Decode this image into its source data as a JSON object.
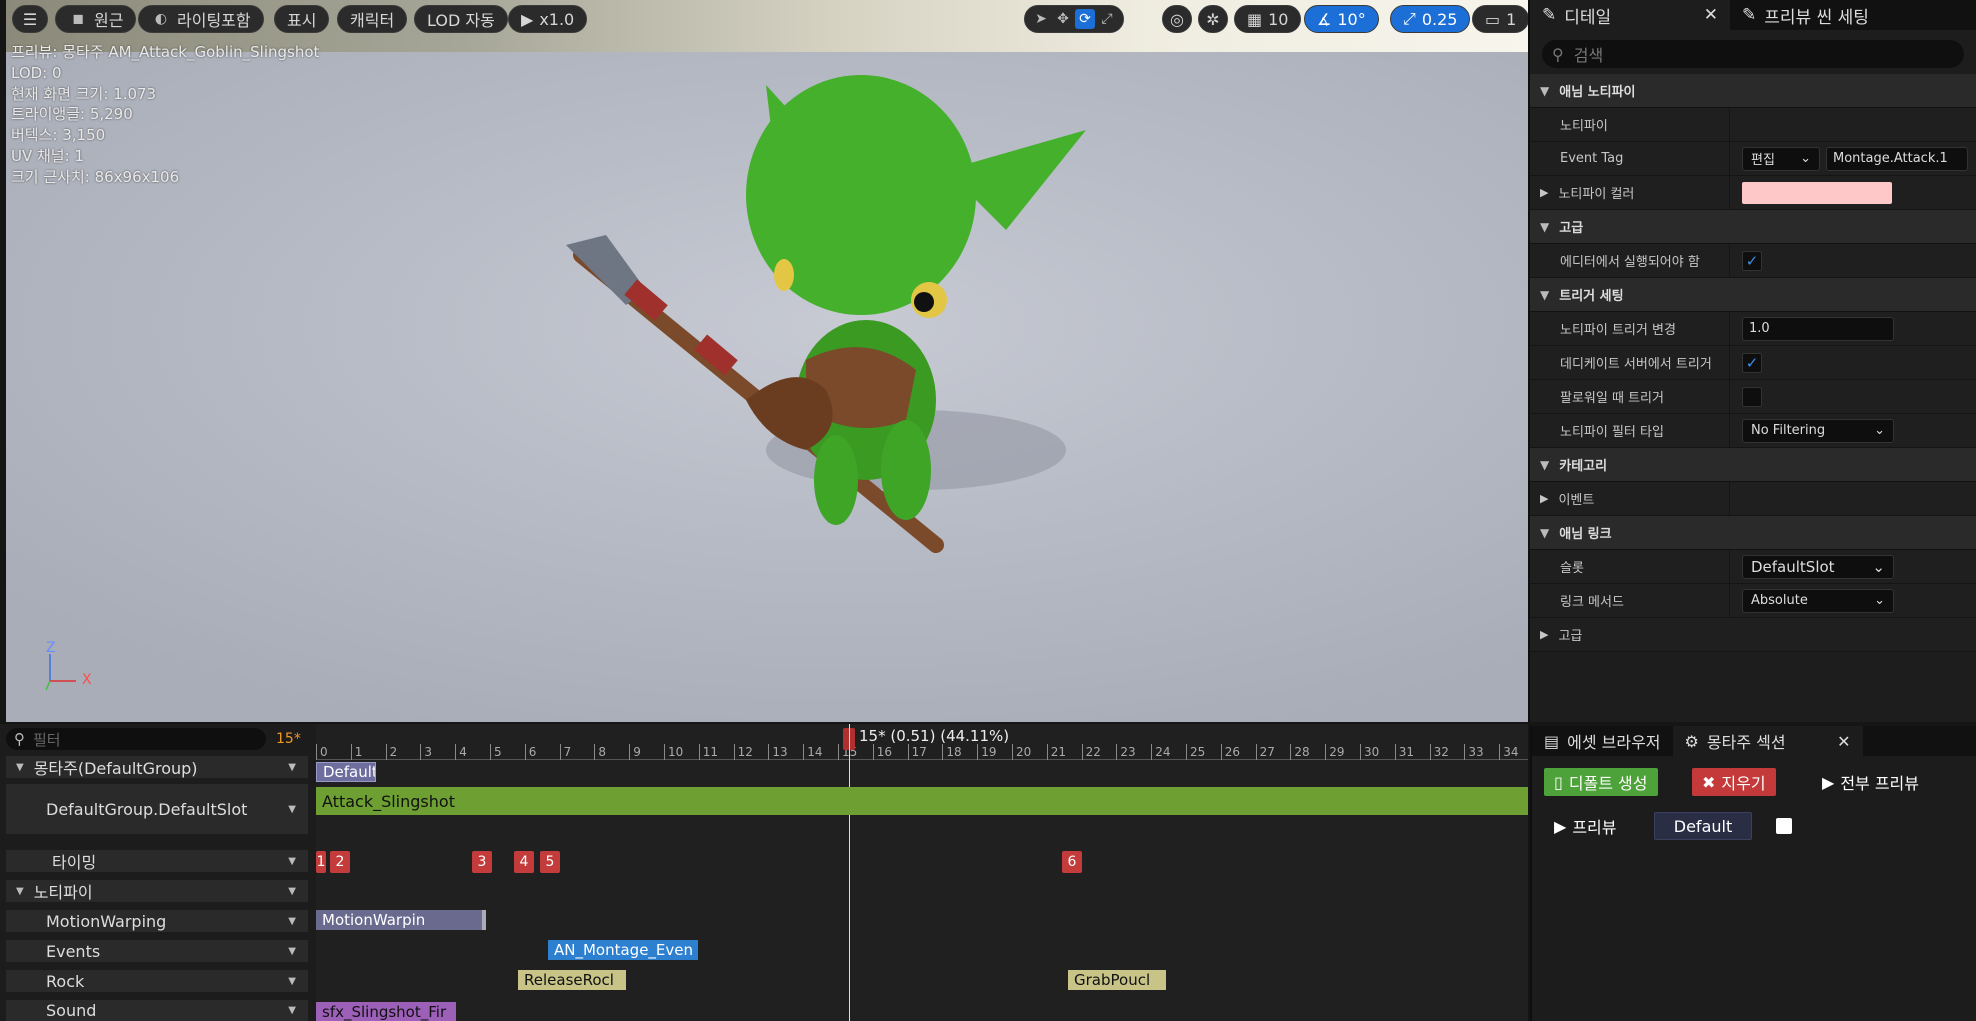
{
  "viewport_toolbar": {
    "menu_icon": "hamburger-icon",
    "perspective": "원근",
    "lighting": "라이팅포함",
    "show": "표시",
    "character": "캐릭터",
    "lod": "LOD 자동",
    "speed": "x1.0",
    "grid_value": "10",
    "angle_value": "10°",
    "scale_value": "0.25",
    "camera_value": "1"
  },
  "stats": [
    "프리뷰: 몽타주 AM_Attack_Goblin_Slingshot",
    "LOD: 0",
    "현재 화면 크기: 1.073",
    "트라이앵글: 5,290",
    "버텍스: 3,150",
    "UV 채널: 1",
    "크기 근사치: 86x96x106"
  ],
  "axis": {
    "z": "Z",
    "x": "X"
  },
  "details": {
    "tab_details": "디테일",
    "tab_preview": "프리뷰 씬 세팅",
    "search_placeholder": "검색",
    "sections": {
      "anim_notify": "애님 노티파이",
      "notify": "노티파이",
      "event_tag": "Event Tag",
      "edit": "편집",
      "event_tag_value": "Montage.Attack.1",
      "notify_color": "노티파이 컬러",
      "notify_color_hex": "#ffc8c8",
      "advanced": "고급",
      "run_in_editor": "에디터에서 실행되어야 함",
      "trigger_settings": "트리거 세팅",
      "notify_trigger_chance": "노티파이 트리거 변경",
      "trigger_chance_value": "1.0",
      "trigger_dedicated": "데디케이트 서버에서 트리거",
      "trigger_follower": "팔로워일 때 트리거",
      "filter_type": "노티파이 필터 타입",
      "filter_type_value": "No Filtering",
      "category": "카테고리",
      "event": "이벤트",
      "anim_link": "애님 링크",
      "slot": "슬롯",
      "slot_value": "DefaultSlot",
      "link_method": "링크 메서드",
      "link_method_value": "Absolute",
      "advanced2": "고급"
    }
  },
  "timeline": {
    "filter_placeholder": "필터",
    "frame": "15*",
    "current": "15* (0.51) (44.11%)",
    "ticks": [
      "0",
      "1",
      "2",
      "3",
      "4",
      "5",
      "6",
      "7",
      "8",
      "9",
      "10",
      "11",
      "12",
      "13",
      "14",
      "15",
      "16",
      "17",
      "18",
      "19",
      "20",
      "21",
      "22",
      "23",
      "24",
      "25",
      "26",
      "27",
      "28",
      "29",
      "30",
      "31",
      "32",
      "33",
      "34"
    ],
    "tracks": {
      "montage": "몽타주(DefaultGroup)",
      "slot": "DefaultGroup.DefaultSlot",
      "timing": "타이밍",
      "notifies": "노티파이",
      "motion": "MotionWarping",
      "events": "Events",
      "rock": "Rock",
      "sound": "Sound"
    },
    "segments": {
      "default": "Default",
      "attack": "Attack_Slingshot",
      "motion": "MotionWarpin",
      "montage_event": "AN_Montage_Even",
      "release": "ReleaseRocl",
      "grab": "GrabPoucl",
      "sfx": "sfx_Slingshot_Fir"
    },
    "timing_markers": [
      "1",
      "2",
      "3",
      "4",
      "5",
      "6"
    ]
  },
  "montage_panel": {
    "tab_asset": "에셋 브라우저",
    "tab_sections": "몽타주 섹션",
    "create_default": "디폴트 생성",
    "clear": "지우기",
    "preview_all": "전부 프리뷰",
    "preview": "프리뷰",
    "section_default": "Default"
  }
}
